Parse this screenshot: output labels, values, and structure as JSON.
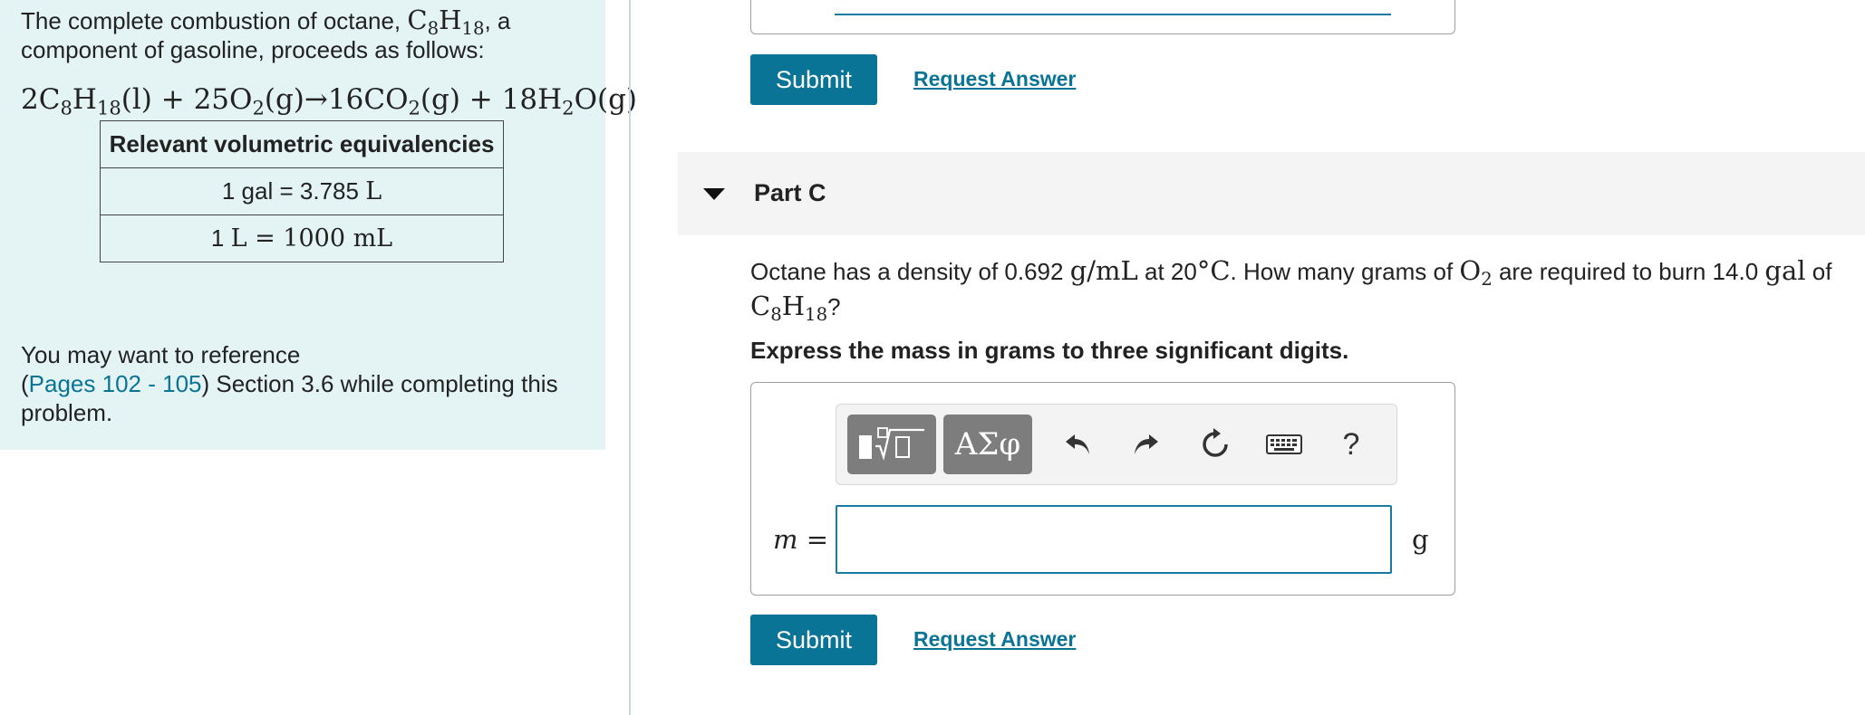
{
  "left_panel": {
    "intro_text": "The complete combustion of octane, ",
    "octane_formula": {
      "symbol_c": "C",
      "sub_c": "8",
      "symbol_h": "H",
      "sub_h": "18"
    },
    "intro_suffix": ", a component of gasoline, proceeds as follows:",
    "equation": {
      "coef1": "2",
      "c": "C",
      "c_sub": "8",
      "h": "H",
      "h_sub": "18",
      "state1": "(l)",
      "plus1": " + ",
      "coef2": "25",
      "o2": "O",
      "o2_sub": "2",
      "state2": "(g)",
      "arrow": "→",
      "coef3": "16",
      "co2": "CO",
      "co2_sub": "2",
      "state3": "(g)",
      "plus2": " + ",
      "coef4": "18",
      "h2o_h": "H",
      "h2o_sub": "2",
      "h2o_o": "O",
      "state4": "(g)"
    },
    "table": {
      "header": "Relevant volumetric equivalencies",
      "rows": [
        {
          "left": "1 gal = 3.785 ",
          "unit": "L"
        },
        {
          "left": "1 ",
          "unit": "L = 1000 mL"
        }
      ]
    },
    "reference": {
      "prefix": "You may want to reference",
      "open_paren": "(",
      "link": "Pages 102 - 105",
      "suffix": ") Section 3.6 while completing this problem."
    }
  },
  "top_section": {
    "submit_label": "Submit",
    "request_answer_label": "Request Answer"
  },
  "part_c": {
    "title": "Part C",
    "question": {
      "t1": "Octane has a density of 0.692 ",
      "density_unit": "g/mL",
      "t2": " at 20",
      "temp_unit": "°C",
      "t3": ". How many grams of ",
      "o2": "O",
      "o2_sub": "2",
      "t4": " are required to burn 14.0  ",
      "gal": "gal",
      "t5": " of ",
      "c": "C",
      "c_sub": "8",
      "h": "H",
      "h_sub": "18",
      "t6": "?"
    },
    "instruction": "Express the mass in grams to three significant digits.",
    "toolbar": {
      "symbols_label": "ΑΣφ",
      "help_label": "?"
    },
    "input": {
      "variable": "m",
      "equals": " =",
      "value": "",
      "unit": "g"
    },
    "submit_label": "Submit",
    "request_answer_label": "Request Answer"
  },
  "icons": [
    "templates-icon",
    "undo-icon",
    "redo-icon",
    "reset-icon",
    "keyboard-icon",
    "help-icon",
    "collapse-caret-icon"
  ],
  "colors": {
    "accent": "#0a7497",
    "panel_bg": "#e4f4f4",
    "input_border": "#1a7ba0",
    "toolbar_btn": "#7d7d7d"
  }
}
